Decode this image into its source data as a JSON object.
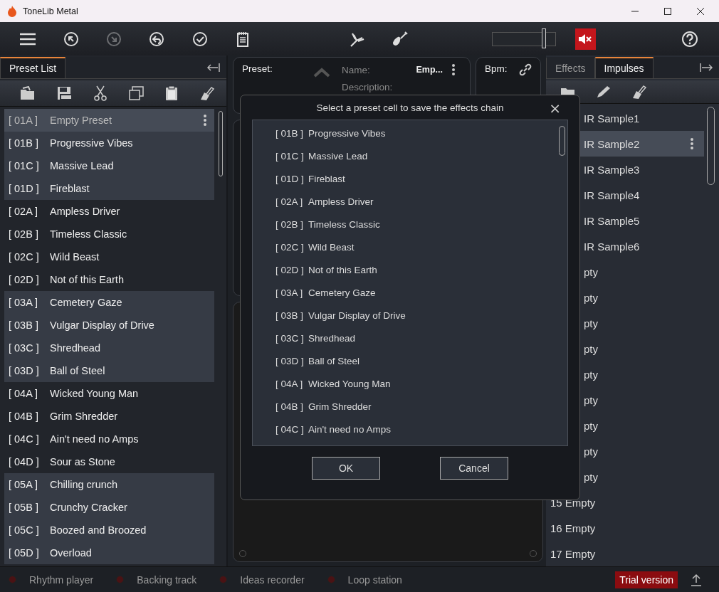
{
  "window": {
    "title": "ToneLib Metal"
  },
  "toolbar": {
    "volume": {
      "level": 0.82
    },
    "mute": {
      "on": true
    },
    "redo_disabled": true
  },
  "left_panel": {
    "tabs": [
      {
        "label": "Preset List",
        "selected": true
      }
    ],
    "presets": [
      {
        "code": "[ 01A ]",
        "name": "Empty Preset",
        "selected": true,
        "shaded": true
      },
      {
        "code": "[ 01B ]",
        "name": "Progressive Vibes",
        "selected": false,
        "shaded": true
      },
      {
        "code": "[ 01C ]",
        "name": "Massive Lead",
        "selected": false,
        "shaded": true
      },
      {
        "code": "[ 01D ]",
        "name": "Fireblast",
        "selected": false,
        "shaded": true
      },
      {
        "code": "[ 02A ]",
        "name": "Ampless Driver",
        "selected": false,
        "shaded": false
      },
      {
        "code": "[ 02B ]",
        "name": "Timeless Classic",
        "selected": false,
        "shaded": false
      },
      {
        "code": "[ 02C ]",
        "name": "Wild Beast",
        "selected": false,
        "shaded": false
      },
      {
        "code": "[ 02D ]",
        "name": "Not of this Earth",
        "selected": false,
        "shaded": false
      },
      {
        "code": "[ 03A ]",
        "name": "Cemetery Gaze",
        "selected": false,
        "shaded": true
      },
      {
        "code": "[ 03B ]",
        "name": "Vulgar Display of Drive",
        "selected": false,
        "shaded": true
      },
      {
        "code": "[ 03C ]",
        "name": "Shredhead",
        "selected": false,
        "shaded": true
      },
      {
        "code": "[ 03D ]",
        "name": "Ball of Steel",
        "selected": false,
        "shaded": true
      },
      {
        "code": "[ 04A ]",
        "name": "Wicked Young Man",
        "selected": false,
        "shaded": false
      },
      {
        "code": "[ 04B ]",
        "name": "Grim Shredder",
        "selected": false,
        "shaded": false
      },
      {
        "code": "[ 04C ]",
        "name": "Ain't need no Amps",
        "selected": false,
        "shaded": false
      },
      {
        "code": "[ 04D ]",
        "name": "Sour as Stone",
        "selected": false,
        "shaded": false
      },
      {
        "code": "[ 05A ]",
        "name": "Chilling crunch",
        "selected": false,
        "shaded": true
      },
      {
        "code": "[ 05B ]",
        "name": "Crunchy Cracker",
        "selected": false,
        "shaded": true
      },
      {
        "code": "[ 05C ]",
        "name": "Boozed and Broozed",
        "selected": false,
        "shaded": true
      },
      {
        "code": "[ 05D ]",
        "name": "Overload",
        "selected": false,
        "shaded": true
      }
    ]
  },
  "preset_card": {
    "label": "Preset:",
    "name_label": "Name:",
    "name_value": "Emp...",
    "description_label": "Description:"
  },
  "bpm_card": {
    "label": "Bpm:"
  },
  "right_panel": {
    "tabs": [
      {
        "label": "Effects",
        "selected": false
      },
      {
        "label": "Impulses",
        "selected": true
      }
    ],
    "impulses": [
      {
        "label": "IR Sample1",
        "selected": false,
        "covered": true
      },
      {
        "label": "IR Sample2",
        "selected": true,
        "covered": true
      },
      {
        "label": "IR Sample3",
        "selected": false,
        "covered": true
      },
      {
        "label": "IR Sample4",
        "selected": false,
        "covered": true
      },
      {
        "label": "IR Sample5",
        "selected": false,
        "covered": true
      },
      {
        "label": "IR Sample6",
        "selected": false,
        "covered": true
      },
      {
        "label": "pty",
        "selected": false,
        "covered": true
      },
      {
        "label": "pty",
        "selected": false,
        "covered": true
      },
      {
        "label": "pty",
        "selected": false,
        "covered": true
      },
      {
        "label": "pty",
        "selected": false,
        "covered": true
      },
      {
        "label": "pty",
        "selected": false,
        "covered": true
      },
      {
        "label": "pty",
        "selected": false,
        "covered": true
      },
      {
        "label": "pty",
        "selected": false,
        "covered": true
      },
      {
        "label": "pty",
        "selected": false,
        "covered": true
      },
      {
        "label": "pty",
        "selected": false,
        "covered": true
      },
      {
        "label": "15 Empty",
        "selected": false,
        "covered": false
      },
      {
        "label": "16 Empty",
        "selected": false,
        "covered": false
      },
      {
        "label": "17 Empty",
        "selected": false,
        "covered": false
      }
    ]
  },
  "dialog": {
    "title": "Select a preset cell to save the effects chain",
    "close": "×",
    "cells": [
      {
        "code": "[ 01B ]",
        "name": "Progressive Vibes"
      },
      {
        "code": "[ 01C ]",
        "name": "Massive Lead"
      },
      {
        "code": "[ 01D ]",
        "name": "Fireblast"
      },
      {
        "code": "[ 02A ]",
        "name": "Ampless Driver"
      },
      {
        "code": "[ 02B ]",
        "name": "Timeless Classic"
      },
      {
        "code": "[ 02C ]",
        "name": "Wild Beast"
      },
      {
        "code": "[ 02D ]",
        "name": "Not of this Earth"
      },
      {
        "code": "[ 03A ]",
        "name": "Cemetery Gaze"
      },
      {
        "code": "[ 03B ]",
        "name": "Vulgar Display of Drive"
      },
      {
        "code": "[ 03C ]",
        "name": "Shredhead"
      },
      {
        "code": "[ 03D ]",
        "name": "Ball of Steel"
      },
      {
        "code": "[ 04A ]",
        "name": "Wicked Young Man"
      },
      {
        "code": "[ 04B ]",
        "name": "Grim Shredder"
      },
      {
        "code": "[ 04C ]",
        "name": "Ain't need no Amps"
      }
    ],
    "buttons": [
      "OK",
      "Cancel"
    ]
  },
  "status_bar": {
    "items": [
      {
        "label": "Rhythm player",
        "on": false
      },
      {
        "label": "Backing track",
        "on": false
      },
      {
        "label": "Ideas recorder",
        "on": false
      },
      {
        "label": "Loop station",
        "on": false
      }
    ],
    "badge": "Trial version"
  }
}
